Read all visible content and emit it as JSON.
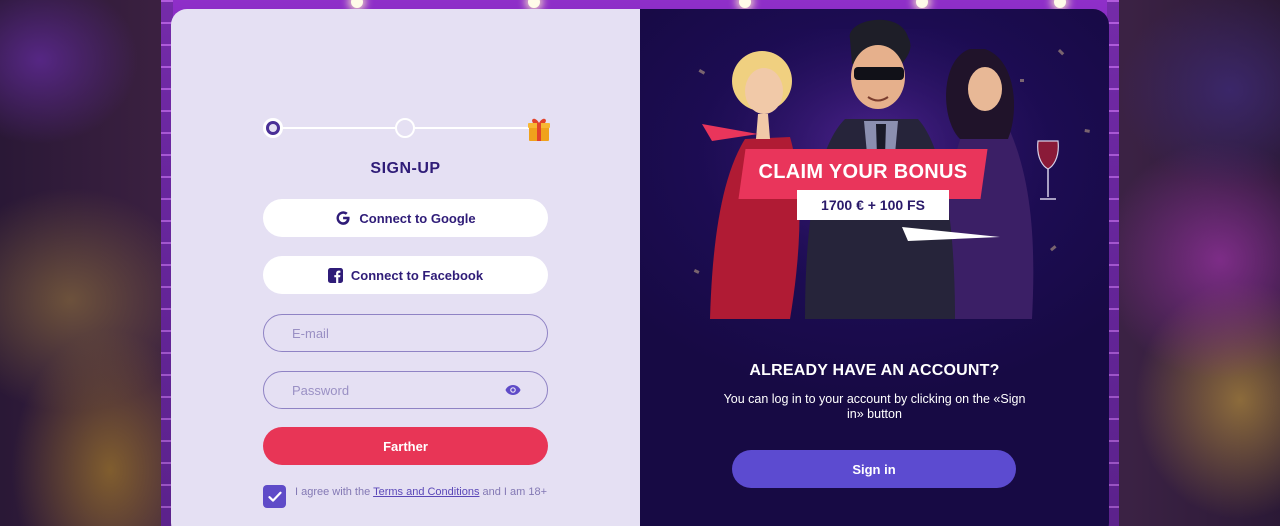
{
  "stepper": {
    "steps": 3,
    "current_step": 1
  },
  "signup": {
    "title": "SIGN-UP",
    "google_label": "Connect to Google",
    "facebook_label": "Connect to Facebook",
    "email_placeholder": "E-mail",
    "password_placeholder": "Password",
    "submit_label": "Farther",
    "agree_prefix": "I agree with the ",
    "terms_link": "Terms and Conditions",
    "agree_suffix": " and I am 18+",
    "agree_checked": true
  },
  "promo": {
    "headline": "CLAIM YOUR BONUS",
    "bonus": "1700 € + 100 FS"
  },
  "account": {
    "title": "ALREADY HAVE AN ACCOUNT?",
    "subtitle": "You can log in to your account by clicking on the «Sign in» button",
    "signin_label": "Sign in"
  },
  "icons": [
    "gift-icon",
    "google-icon",
    "facebook-icon",
    "eye-icon",
    "checkmark-icon"
  ],
  "colors": {
    "accent_red": "#e83556",
    "accent_purple": "#5c4bd0",
    "text_dark": "#2f1c78",
    "left_panel_bg": "#e5e0f3",
    "right_panel_bg": "#1c0c52"
  }
}
